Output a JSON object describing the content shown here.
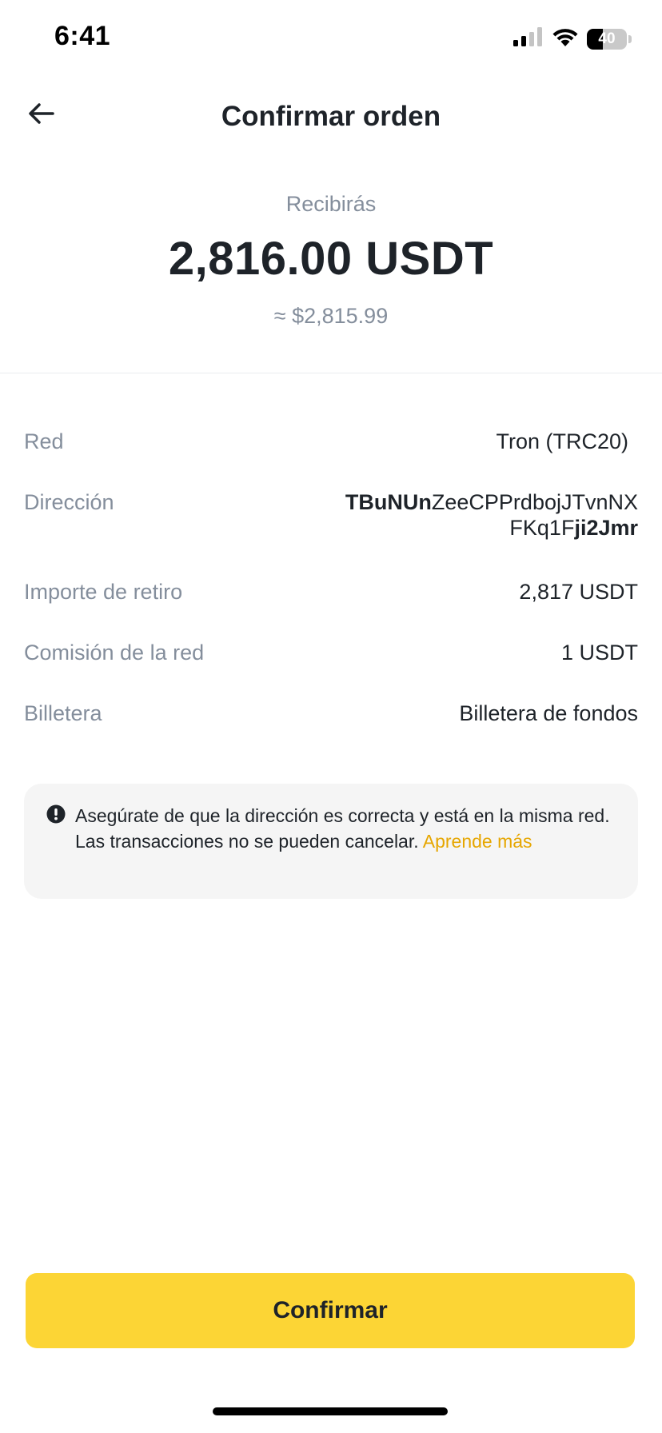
{
  "status_bar": {
    "time": "6:41",
    "battery_level": "40",
    "battery_fraction": 0.4,
    "icons": [
      "signal-icon",
      "wifi-icon",
      "battery-icon"
    ]
  },
  "header": {
    "title": "Confirmar orden",
    "back_icon": "arrow-left-icon"
  },
  "summary": {
    "label": "Recibirás",
    "amount": "2,816.00 USDT",
    "fiat_equivalent": "≈ $2,815.99"
  },
  "details": {
    "network": {
      "label": "Red",
      "value": "Tron (TRC20)"
    },
    "address": {
      "label": "Dirección",
      "prefix": "TBuNUn",
      "middle": "ZeeCPPrdbojJTvnNXFKq1F",
      "suffix": "ji2Jmr"
    },
    "withdraw_amount": {
      "label": "Importe de retiro",
      "value": "2,817 USDT"
    },
    "network_fee": {
      "label": "Comisión de la red",
      "value": "1 USDT"
    },
    "wallet": {
      "label": "Billetera",
      "value": "Billetera de fondos"
    }
  },
  "warning": {
    "line1": "Asegúrate de que la dirección es correcta y está en la misma red.",
    "line2": "Las transacciones no se pueden cancelar.",
    "link": "Aprende más",
    "icon": "alert-circle-icon"
  },
  "actions": {
    "confirm_label": "Confirmar"
  },
  "colors": {
    "accent": "#fcd535",
    "link": "#e6a600",
    "muted_text": "#848e9c",
    "primary_text": "#1e2329",
    "warning_bg": "#f5f5f5"
  }
}
